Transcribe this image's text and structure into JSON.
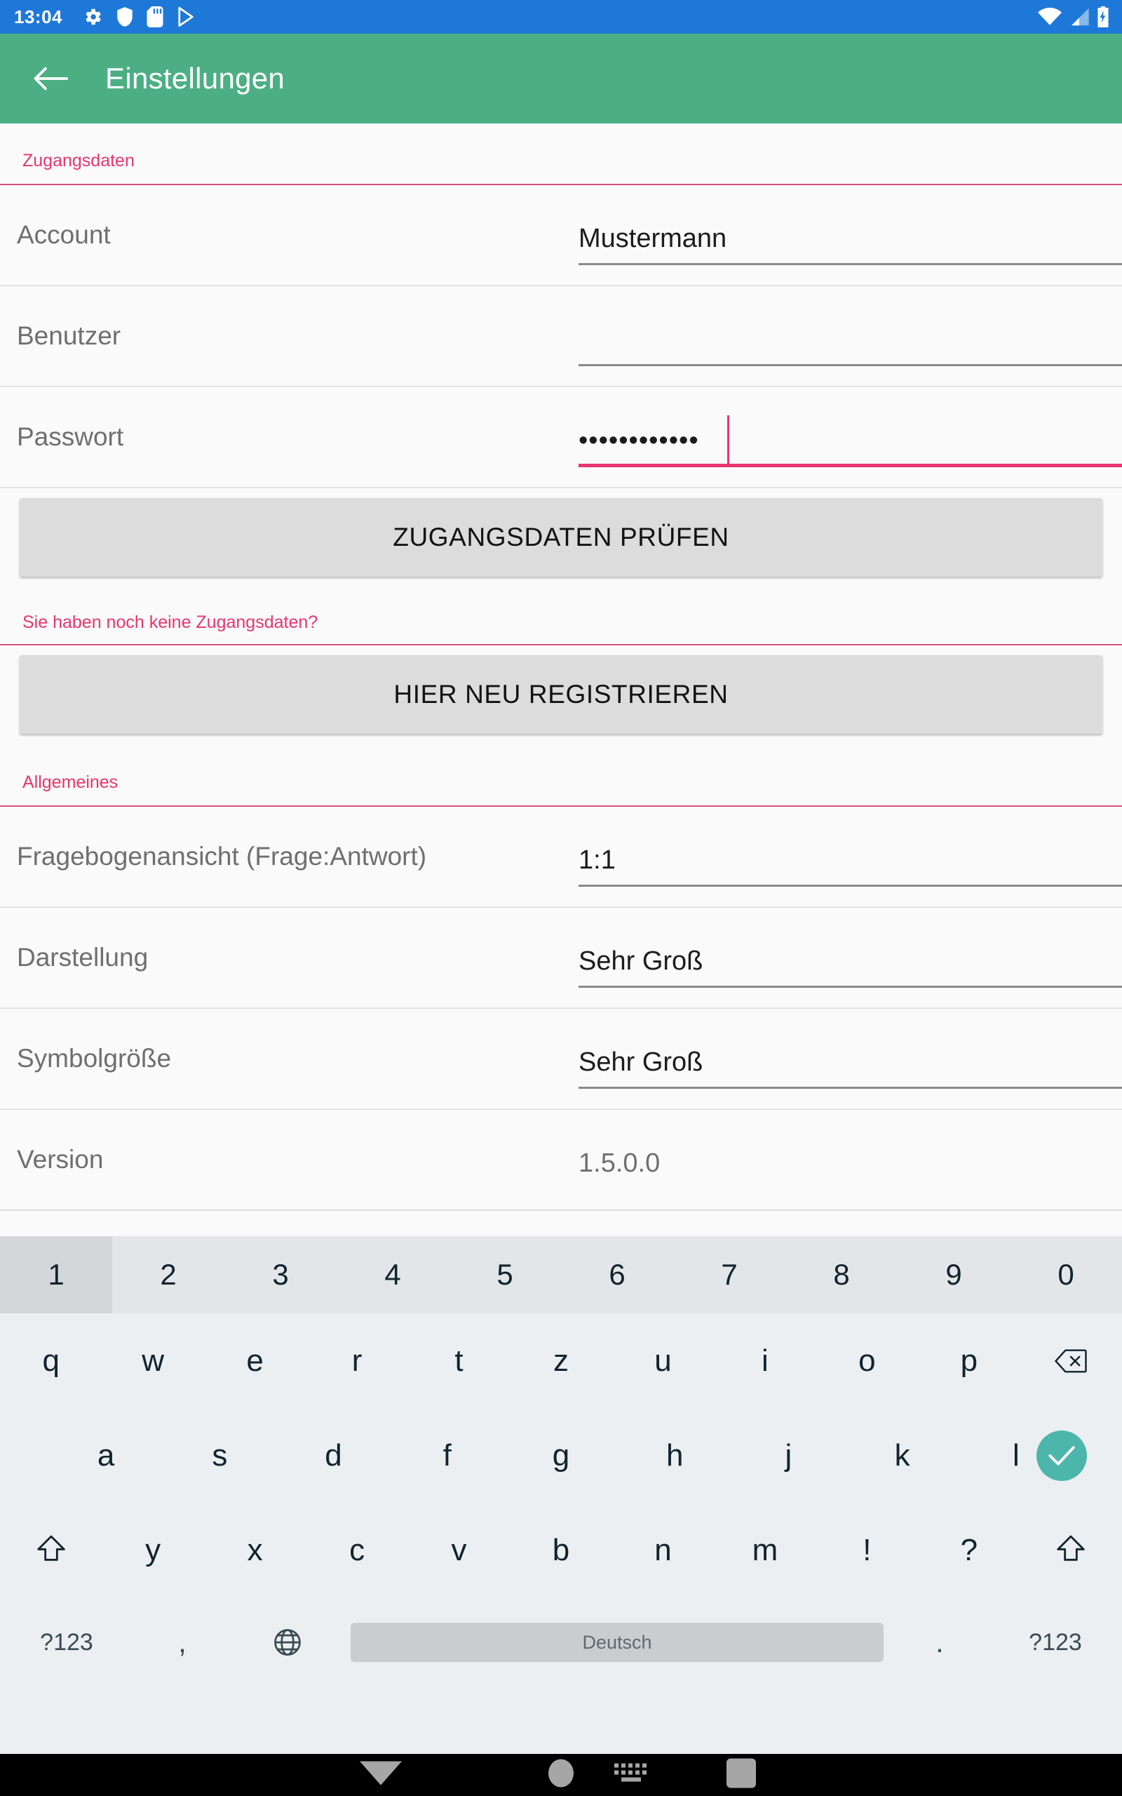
{
  "status_bar": {
    "time": "13:04",
    "left_icons": [
      "gear-icon",
      "shield-icon",
      "sd-card-icon",
      "play-store-icon"
    ],
    "right_icons": [
      "wifi-icon",
      "cellular-signal-icon",
      "battery-charging-icon"
    ],
    "background_color": "#1E78D7"
  },
  "app_bar": {
    "back_label": "back-arrow-icon",
    "title": "Einstellungen",
    "background_color": "#4CAF83"
  },
  "accent_color": "#E8366E",
  "sections": {
    "credentials": {
      "header": "Zugangsdaten",
      "fields": [
        {
          "label": "Account",
          "value": "Mustermann",
          "focused": false
        },
        {
          "label": "Benutzer",
          "value": "",
          "focused": false
        },
        {
          "label": "Passwort",
          "value": "••••••••••••",
          "focused": true
        }
      ],
      "check_button": "ZUGANGSDATEN PRÜFEN",
      "register_hint": "Sie haben noch keine Zugangsdaten?",
      "register_button": "HIER NEU REGISTRIEREN"
    },
    "general": {
      "header": "Allgemeines",
      "rows": [
        {
          "label": "Fragebogenansicht (Frage:Antwort)",
          "value": "1:1",
          "editable": true
        },
        {
          "label": "Darstellung",
          "value": "Sehr Groß",
          "editable": true
        },
        {
          "label": "Symbolgröße",
          "value": "Sehr Groß",
          "editable": true
        },
        {
          "label": "Version",
          "value": "1.5.0.0",
          "editable": false
        }
      ]
    }
  },
  "keyboard": {
    "language": "Deutsch",
    "number_row": [
      "1",
      "2",
      "3",
      "4",
      "5",
      "6",
      "7",
      "8",
      "9",
      "0"
    ],
    "pressed_key": "1",
    "row_q": [
      "q",
      "w",
      "e",
      "r",
      "t",
      "z",
      "u",
      "i",
      "o",
      "p"
    ],
    "backspace": "backspace-icon",
    "row_a": [
      "a",
      "s",
      "d",
      "f",
      "g",
      "h",
      "j",
      "k",
      "l"
    ],
    "enter": "enter-check-icon",
    "enter_color": "#4DB6AC",
    "row_z": [
      "y",
      "x",
      "c",
      "v",
      "b",
      "n",
      "m",
      "!",
      "?"
    ],
    "shift_left": "shift-icon",
    "shift_right": "shift-icon",
    "symbols_left": "?123",
    "comma": ",",
    "globe": "globe-icon",
    "period": ".",
    "symbols_right": "?123"
  },
  "nav_bar": {
    "back": "back-down-triangle-icon",
    "home": "home-circle-icon",
    "keyboard_switch": "keyboard-icon",
    "recents": "recents-square-icon"
  }
}
